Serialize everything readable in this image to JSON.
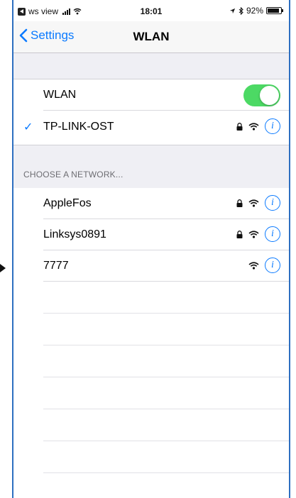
{
  "status_bar": {
    "back_app": "ws view",
    "time": "18:01",
    "battery": "92%"
  },
  "navbar": {
    "back_label": "Settings",
    "title": "WLAN"
  },
  "wlan_row": {
    "label": "WLAN",
    "toggle_on": true
  },
  "connected": {
    "name": "TP-LINK-OST",
    "secured": true
  },
  "section_header": "CHOOSE A NETWORK...",
  "networks": [
    {
      "name": "AppleFos",
      "secured": true
    },
    {
      "name": "Linksys0891",
      "secured": true
    },
    {
      "name": "7777",
      "secured": false
    }
  ],
  "colors": {
    "accent": "#0a7aff",
    "toggle_on": "#4cd964",
    "frame": "#2d6fc0"
  },
  "icons": {
    "info": "info-icon",
    "lock": "lock-icon",
    "wifi": "wifi-icon",
    "check": "checkmark-icon"
  }
}
